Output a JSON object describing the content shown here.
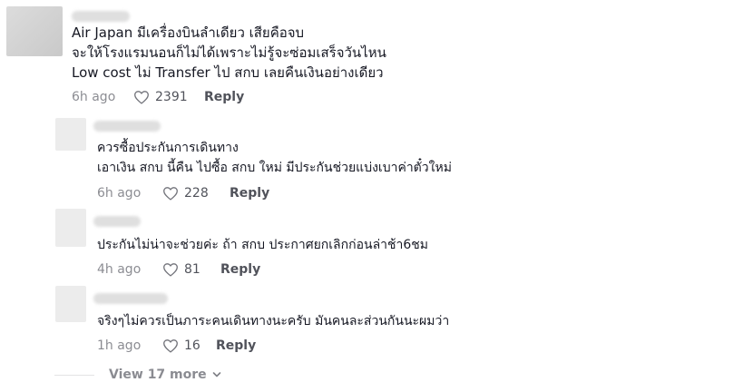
{
  "comments": [
    {
      "lines": [
        "Air Japan มีเครื่องบินลำเดียว เสียคือจบ",
        "จะให้โรงแรมนอนก็ไม่ได้เพราะไม่รู้จะซ่อมเสร็จวันไหน",
        "Low cost ไม่ Transfer ไป สกบ เลยคืนเงินอย่างเดียว"
      ],
      "time": "6h ago",
      "likes": "2391",
      "reply_label": "Reply"
    }
  ],
  "replies": [
    {
      "lines": [
        "ควรซื้อประกันการเดินทาง",
        "เอาเงิน สกบ นี้คืน ไปซื้อ สกบ ใหม่ มีประกันช่วยแบ่งเบาค่าตั๋วใหม่"
      ],
      "time": "6h ago",
      "likes": "228",
      "reply_label": "Reply"
    },
    {
      "lines": [
        "ประกันไม่น่าจะช่วยค่ะ ถ้า สกบ ประกาศยกเลิกก่อนล่าช้า6ชม"
      ],
      "time": "4h ago",
      "likes": "81",
      "reply_label": "Reply"
    },
    {
      "lines": [
        "จริงๆไม่ควรเป็นภาระคนเดินทางนะครับ มันคนละส่วนกันนะผมว่า"
      ],
      "time": "1h ago",
      "likes": "16",
      "reply_label": "Reply"
    }
  ],
  "view_more": {
    "label": "View 17 more"
  },
  "icons": {
    "like": "heart-outline-icon",
    "expand": "chevron-down-icon"
  }
}
